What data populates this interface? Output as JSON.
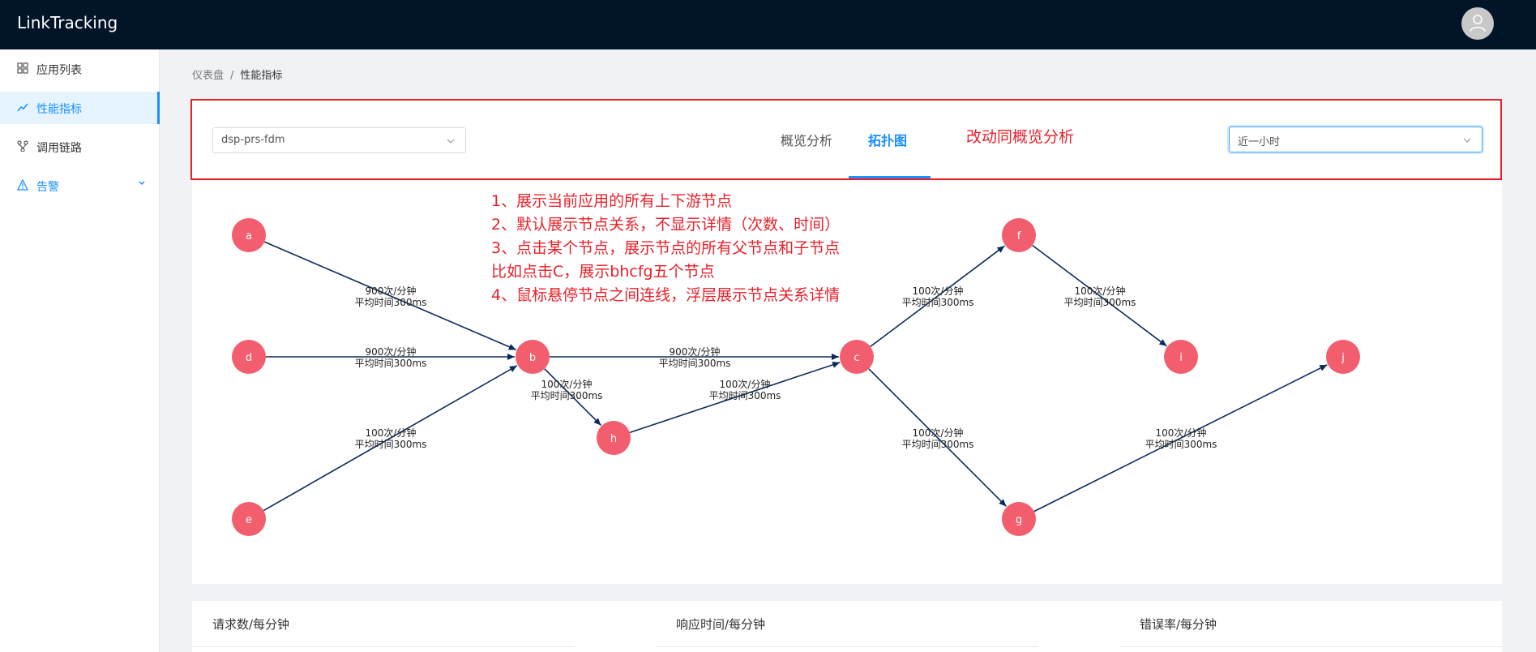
{
  "header": {
    "app_title": "LinkTracking",
    "avatar_icon": "user-icon"
  },
  "sidebar": {
    "items": [
      {
        "label": "应用列表",
        "icon": "grid-icon",
        "active": false
      },
      {
        "label": "性能指标",
        "icon": "line-chart-icon",
        "active": true
      },
      {
        "label": "调用链路",
        "icon": "branch-icon",
        "active": false
      },
      {
        "label": "告警",
        "icon": "warning-icon",
        "active": false
      }
    ]
  },
  "breadcrumb": {
    "items": [
      "仪表盘",
      "性能指标"
    ],
    "separator": "/"
  },
  "filters": {
    "app_select": "dsp-prs-fdm",
    "tabs": [
      "概览分析",
      "拓扑图"
    ],
    "active_tab": "拓扑图",
    "annotation": "改动同概览分析",
    "time_select": "近一小时"
  },
  "notes": [
    "1、展示当前应用的所有上下游节点",
    "2、默认展示节点关系，不显示详情（次数、时间）",
    "3、点击某个节点，展示节点的所有父节点和子节点",
    "比如点击C，展示bhcfg五个节点",
    "4、鼠标悬停节点之间连线，浮层展示节点关系详情"
  ],
  "topology": {
    "node_color": "#f25e6e",
    "edge_color": "#0b2a5c",
    "nodes": [
      "a",
      "d",
      "e",
      "b",
      "h",
      "c",
      "f",
      "g",
      "i",
      "j"
    ],
    "edges": [
      {
        "from": "a",
        "to": "b",
        "count": "900次/分钟",
        "avg": "平均时间300ms"
      },
      {
        "from": "d",
        "to": "b",
        "count": "900次/分钟",
        "avg": "平均时间300ms"
      },
      {
        "from": "e",
        "to": "b",
        "count": "100次/分钟",
        "avg": "平均时间300ms"
      },
      {
        "from": "b",
        "to": "c",
        "count": "900次/分钟",
        "avg": "平均时间300ms"
      },
      {
        "from": "b",
        "to": "h",
        "count": "100次/分钟",
        "avg": "平均时间300ms"
      },
      {
        "from": "h",
        "to": "c",
        "count": "100次/分钟",
        "avg": "平均时间300ms"
      },
      {
        "from": "c",
        "to": "f",
        "count": "100次/分钟",
        "avg": "平均时间300ms"
      },
      {
        "from": "f",
        "to": "i",
        "count": "100次/分钟",
        "avg": "平均时间300ms"
      },
      {
        "from": "c",
        "to": "g",
        "count": "100次/分钟",
        "avg": "平均时间300ms"
      },
      {
        "from": "g",
        "to": "j",
        "count": "100次/分钟",
        "avg": "平均时间300ms"
      }
    ]
  },
  "stats": {
    "titles": [
      "请求数/每分钟",
      "响应时间/每分钟",
      "错误率/每分钟"
    ]
  }
}
